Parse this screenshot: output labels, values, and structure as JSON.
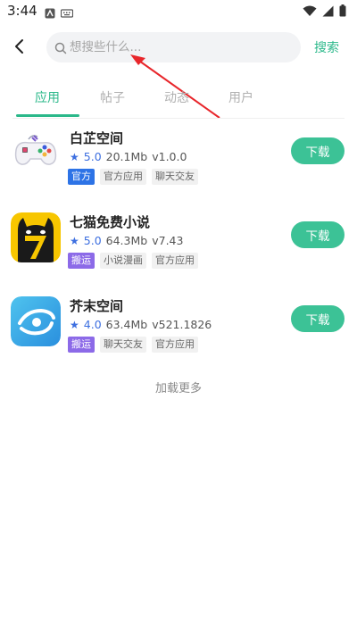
{
  "status_bar": {
    "time": "3:44",
    "left_icons": [
      "notification-a-icon",
      "keyboard-icon"
    ],
    "right_icons": [
      "wifi-icon",
      "signal-icon",
      "battery-icon"
    ]
  },
  "search": {
    "placeholder": "想搜些什么...",
    "value": "",
    "button_label": "搜索"
  },
  "tabs": [
    {
      "label": "应用",
      "active": true
    },
    {
      "label": "帖子",
      "active": false
    },
    {
      "label": "动态",
      "active": false
    },
    {
      "label": "用户",
      "active": false
    }
  ],
  "apps": [
    {
      "name": "白芷空间",
      "rating": "5.0",
      "size": "20.1Mb",
      "version": "v1.0.0",
      "tags": [
        {
          "label": "官方",
          "style": "primary-blue"
        },
        {
          "label": "官方应用",
          "style": "gray"
        },
        {
          "label": "聊天交友",
          "style": "gray"
        }
      ],
      "download_label": "下载",
      "icon": "gamepad-icon"
    },
    {
      "name": "七猫免费小说",
      "rating": "5.0",
      "size": "64.3Mb",
      "version": "v7.43",
      "tags": [
        {
          "label": "搬运",
          "style": "primary-purple"
        },
        {
          "label": "小说漫画",
          "style": "gray"
        },
        {
          "label": "官方应用",
          "style": "gray"
        }
      ],
      "download_label": "下载",
      "icon": "black-cat-seven-icon"
    },
    {
      "name": "芥末空间",
      "rating": "4.0",
      "size": "63.4Mb",
      "version": "v521.1826",
      "tags": [
        {
          "label": "搬运",
          "style": "primary-purple"
        },
        {
          "label": "聊天交友",
          "style": "gray"
        },
        {
          "label": "官方应用",
          "style": "gray"
        }
      ],
      "download_label": "下载",
      "icon": "eye-swirl-icon"
    }
  ],
  "load_more": "加载更多",
  "colors": {
    "accent": "#2bb88a",
    "download_button": "#3cc296",
    "rating": "#3d6fe0",
    "tag_official": "#2d73e6",
    "tag_ported": "#8c6ae8",
    "annotation_arrow": "#e8262b"
  }
}
